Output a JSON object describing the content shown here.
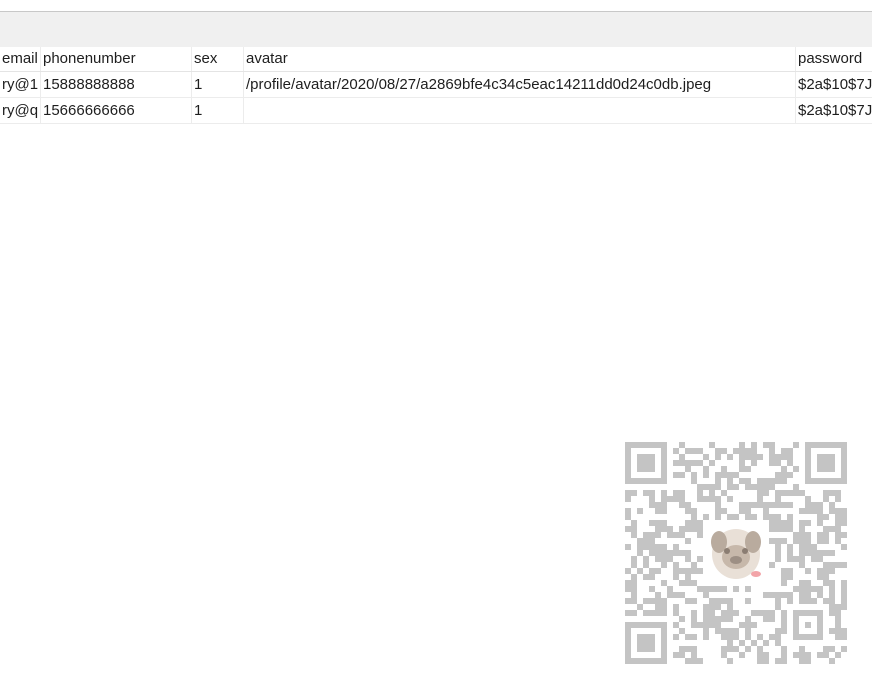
{
  "table": {
    "columns": [
      "email",
      "phonenumber",
      "sex",
      "avatar",
      "password"
    ],
    "rows": [
      {
        "email": "ry@1",
        "phonenumber": "15888888888",
        "sex": "1",
        "avatar": "/profile/avatar/2020/08/27/a2869bfe4c34c5eac14211dd0d24c0db.jpeg",
        "password": "$2a$10$7J"
      },
      {
        "email": "ry@q",
        "phonenumber": "15666666666",
        "sex": "1",
        "avatar": "",
        "password": "$2a$10$7J"
      }
    ]
  },
  "qr_code": {
    "icon": "qr-code-icon",
    "center_icon": "pug-avatar-icon",
    "color": "#c4c4c4"
  }
}
